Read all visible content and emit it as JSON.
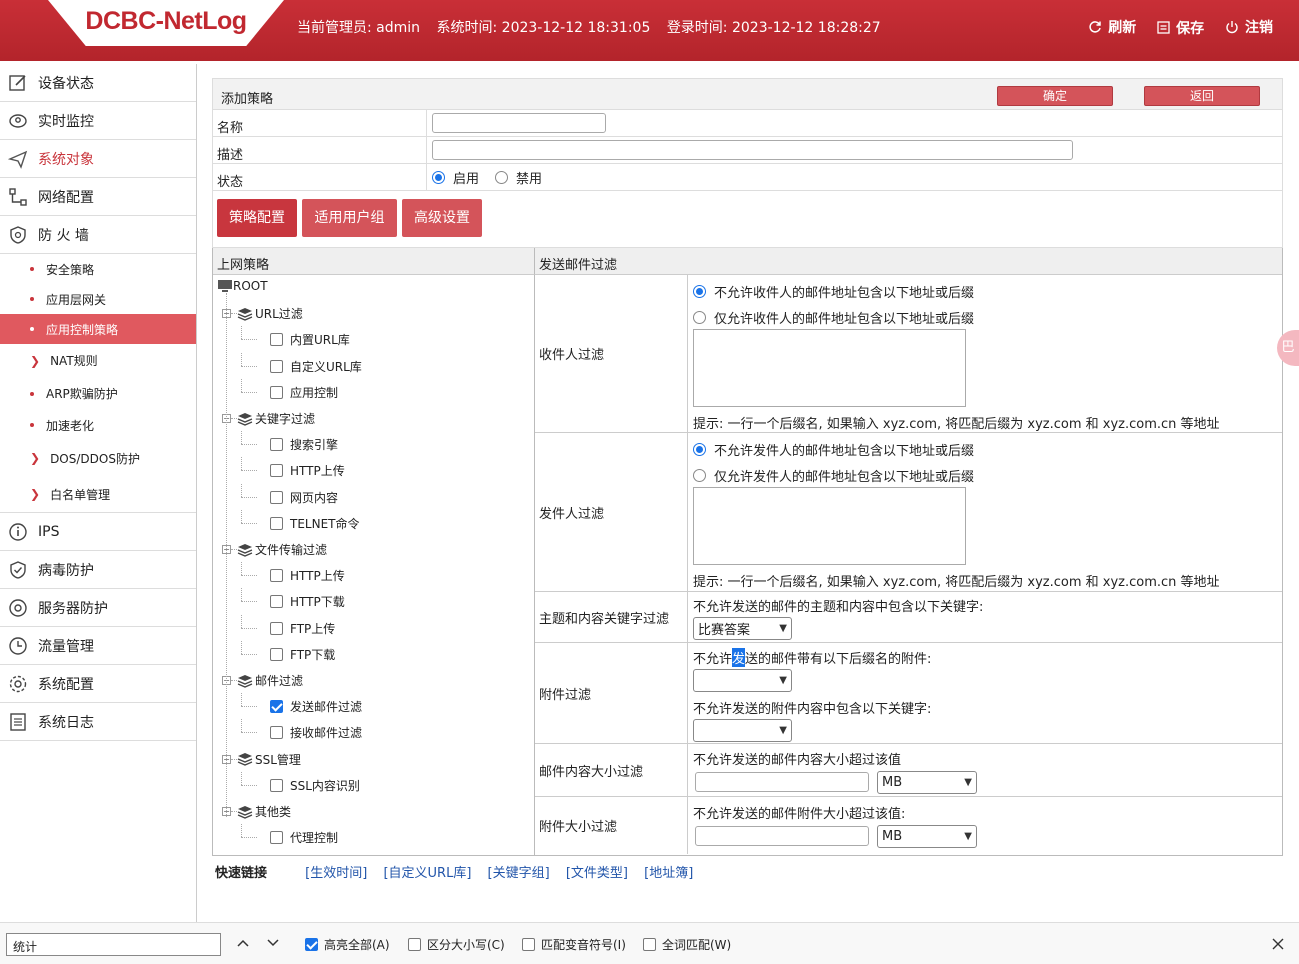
{
  "header": {
    "logo": "DCBC-NetLog",
    "admin": "当前管理员: admin",
    "sys_time": "系统时间: 2023-12-12 18:31:05",
    "login_time": "登录时间: 2023-12-12 18:28:27",
    "refresh": "刷新",
    "save": "保存",
    "logout": "注销"
  },
  "sidebar": {
    "items": [
      {
        "label": "设备状态",
        "icon": "edit-icon"
      },
      {
        "label": "实时监控",
        "icon": "location-icon"
      },
      {
        "label": "系统对象",
        "icon": "paper-plane-icon",
        "active": true
      },
      {
        "label": "网络配置",
        "icon": "network-icon"
      },
      {
        "label": "防 火 墙",
        "icon": "shield-icon"
      }
    ],
    "fw_sub": [
      {
        "label": "安全策略",
        "type": "dot"
      },
      {
        "label": "应用层网关",
        "type": "dot"
      },
      {
        "label": "应用控制策略",
        "type": "dot",
        "active": true
      },
      {
        "label": "NAT规则",
        "type": "chev"
      },
      {
        "label": "ARP欺骗防护",
        "type": "dot"
      },
      {
        "label": "加速老化",
        "type": "dot"
      },
      {
        "label": "DOS/DDOS防护",
        "type": "chev"
      },
      {
        "label": "白名单管理",
        "type": "chev"
      }
    ],
    "items2": [
      {
        "label": "IPS",
        "icon": "info-icon"
      },
      {
        "label": "病毒防护",
        "icon": "shield-check-icon"
      },
      {
        "label": "服务器防护",
        "icon": "server-icon"
      },
      {
        "label": "流量管理",
        "icon": "clock-icon"
      },
      {
        "label": "系统配置",
        "icon": "gear-icon"
      },
      {
        "label": "系统日志",
        "icon": "log-icon"
      }
    ]
  },
  "form": {
    "title": "添加策略",
    "confirm": "确定",
    "back": "返回",
    "name_label": "名称",
    "desc_label": "描述",
    "status_label": "状态",
    "enable": "启用",
    "disable": "禁用"
  },
  "tabs": [
    "策略配置",
    "适用用户组",
    "高级设置"
  ],
  "panel": {
    "left_header": "上网策略",
    "right_header": "发送邮件过滤"
  },
  "tree": [
    {
      "label": "ROOT",
      "level": 0,
      "kind": "root"
    },
    {
      "label": "URL过滤",
      "level": 1,
      "kind": "group"
    },
    {
      "label": "内置URL库",
      "level": 2,
      "checked": false
    },
    {
      "label": "自定义URL库",
      "level": 2,
      "checked": false
    },
    {
      "label": "应用控制",
      "level": 2,
      "checked": false
    },
    {
      "label": "关键字过滤",
      "level": 1,
      "kind": "group"
    },
    {
      "label": "搜索引擎",
      "level": 2,
      "checked": false
    },
    {
      "label": "HTTP上传",
      "level": 2,
      "checked": false
    },
    {
      "label": "网页内容",
      "level": 2,
      "checked": false
    },
    {
      "label": "TELNET命令",
      "level": 2,
      "checked": false
    },
    {
      "label": "文件传输过滤",
      "level": 1,
      "kind": "group"
    },
    {
      "label": "HTTP上传",
      "level": 2,
      "checked": false
    },
    {
      "label": "HTTP下载",
      "level": 2,
      "checked": false
    },
    {
      "label": "FTP上传",
      "level": 2,
      "checked": false
    },
    {
      "label": "FTP下载",
      "level": 2,
      "checked": false
    },
    {
      "label": "邮件过滤",
      "level": 1,
      "kind": "group"
    },
    {
      "label": "发送邮件过滤",
      "level": 2,
      "checked": true
    },
    {
      "label": "接收邮件过滤",
      "level": 2,
      "checked": false
    },
    {
      "label": "SSL管理",
      "level": 1,
      "kind": "group"
    },
    {
      "label": "SSL内容识别",
      "level": 2,
      "checked": false
    },
    {
      "label": "其他类",
      "level": 1,
      "kind": "group"
    },
    {
      "label": "代理控制",
      "level": 2,
      "checked": false
    }
  ],
  "filters": {
    "recv": {
      "label": "收件人过滤",
      "opt1": "不允许收件人的邮件地址包含以下地址或后缀",
      "opt2": "仅允许收件人的邮件地址包含以下地址或后缀",
      "hint": "提示: 一行一个后缀名, 如果输入 xyz.com, 将匹配后缀为 xyz.com 和 xyz.com.cn 等地址"
    },
    "send": {
      "label": "发件人过滤",
      "opt1": "不允许发件人的邮件地址包含以下地址或后缀",
      "opt2": "仅允许发件人的邮件地址包含以下地址或后缀",
      "hint": "提示: 一行一个后缀名, 如果输入 xyz.com, 将匹配后缀为 xyz.com 和 xyz.com.cn 等地址"
    },
    "kw": {
      "label": "主题和内容关键字过滤",
      "desc": "不允许发送的邮件的主题和内容中包含以下关键字:",
      "value": "比赛答案"
    },
    "att": {
      "label": "附件过滤",
      "desc1a": "不允许",
      "desc1b": "发",
      "desc1c": "送的邮件带有以下后缀名的附件:",
      "desc2": "不允许发送的附件内容中包含以下关键字:"
    },
    "size": {
      "label": "邮件内容大小过滤",
      "desc": "不允许发送的邮件内容大小超过该值",
      "unit": "MB"
    },
    "attsize": {
      "label": "附件大小过滤",
      "desc": "不允许发送的邮件附件大小超过该值:",
      "unit": "MB"
    }
  },
  "quick": {
    "label": "快速链接",
    "links": [
      "[生效时间]",
      "[自定义URL库]",
      "[关键字组]",
      "[文件类型]",
      "[地址簿]"
    ]
  },
  "find": {
    "value": "统计",
    "opt1": "高亮全部(A)",
    "opt2": "区分大小写(C)",
    "opt3": "匹配变音符号(I)",
    "opt4": "全词匹配(W)"
  },
  "float": "巴"
}
